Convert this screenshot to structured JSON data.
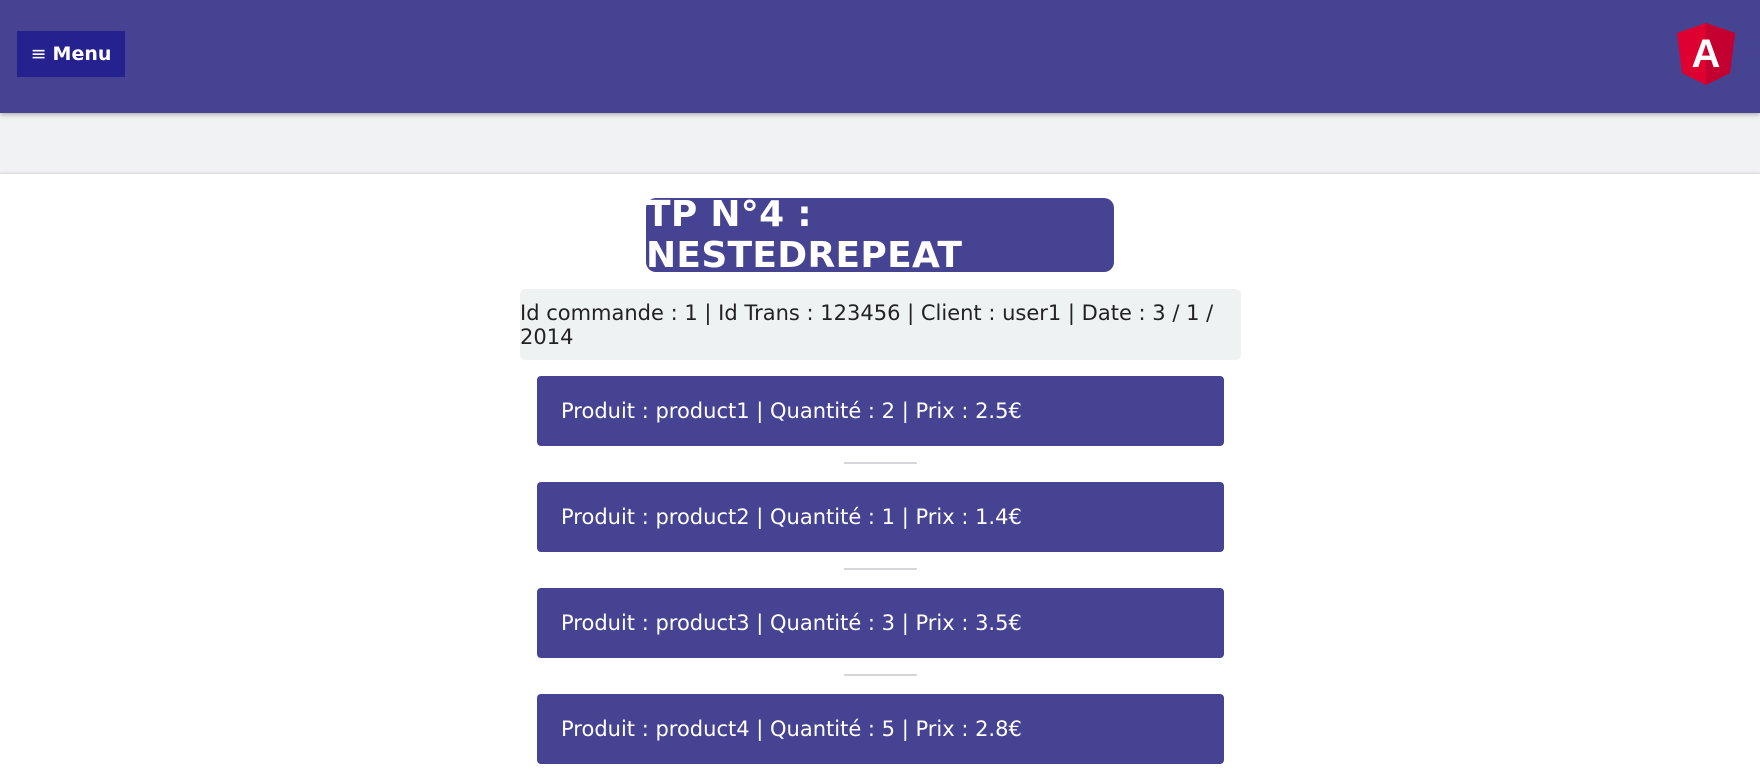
{
  "header": {
    "menu_icon": "≡",
    "menu_label": "Menu",
    "logo_letter": "A",
    "colors": {
      "bar": "#454392",
      "menu_button": "#25218f",
      "logo": "#dd0031"
    }
  },
  "title": "TP N°4 : NESTEDREPEAT",
  "order": {
    "info": "Id commande : 1 | Id Trans : 123456 | Client : user1 | Date : 3 / 1 / 2014"
  },
  "products": [
    {
      "text": "Produit : product1 | Quantité : 2 | Prix : 2.5€"
    },
    {
      "text": "Produit : product2 | Quantité : 1 | Prix : 1.4€"
    },
    {
      "text": "Produit : product3 | Quantité : 3 | Prix : 3.5€"
    },
    {
      "text": "Produit : product4 | Quantité : 5 | Prix : 2.8€"
    }
  ]
}
